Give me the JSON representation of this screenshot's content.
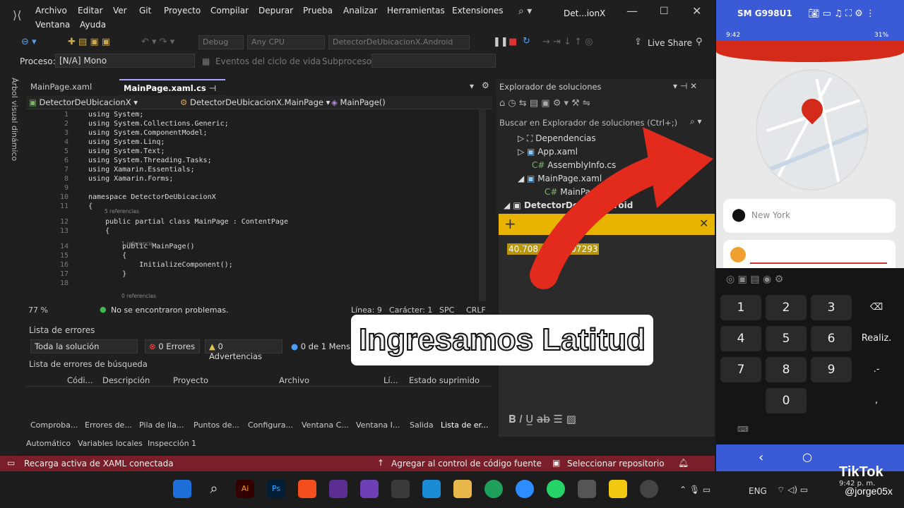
{
  "menu": [
    "Archivo",
    "Editar",
    "Ver",
    "Git",
    "Proyecto",
    "Compilar",
    "Depurar",
    "Prueba",
    "Analizar",
    "Herramientas",
    "Extensiones",
    "Ventana",
    "Ayuda"
  ],
  "window_title": "Det...ionX",
  "toolbar": {
    "config": "Debug",
    "platform": "Any CPU",
    "startup": "DetectorDeUbicacionX.Android",
    "live_share": "Live Share"
  },
  "proc": {
    "label": "Proceso:",
    "value": "[N/A] Mono",
    "events": "Eventos del ciclo de vida",
    "thread": "Subproceso:"
  },
  "side_label": "Árbol visual dinámico",
  "tabs": [
    "MainPage.xaml",
    "MainPage.xaml.cs"
  ],
  "nav": [
    "DetectorDeUbicacionX",
    "DetectorDeUbicacionX.MainPage",
    "MainPage()"
  ],
  "code_lines": [
    {
      "n": "1",
      "t": "using System;"
    },
    {
      "n": "2",
      "t": "using System.Collections.Generic;"
    },
    {
      "n": "3",
      "t": "using System.ComponentModel;"
    },
    {
      "n": "4",
      "t": "using System.Linq;"
    },
    {
      "n": "5",
      "t": "using System.Text;"
    },
    {
      "n": "6",
      "t": "using System.Threading.Tasks;"
    },
    {
      "n": "7",
      "t": "using Xamarin.Essentials;"
    },
    {
      "n": "8",
      "t": "using Xamarin.Forms;"
    },
    {
      "n": "9",
      "t": ""
    },
    {
      "n": "10",
      "t": "namespace DetectorDeUbicacionX"
    },
    {
      "n": "11",
      "t": "{"
    },
    {
      "n": "12",
      "t": "    public partial class MainPage : ContentPage"
    },
    {
      "n": "13",
      "t": "    {"
    },
    {
      "n": "14",
      "t": "        public MainPage()"
    },
    {
      "n": "15",
      "t": "        {"
    },
    {
      "n": "16",
      "t": "            InitializeComponent();"
    },
    {
      "n": "17",
      "t": "        }"
    },
    {
      "n": "18",
      "t": ""
    }
  ],
  "refs": {
    "r5": "5 referencias",
    "r1": "1 referencia",
    "r0": "0 referencias"
  },
  "editor_status": {
    "zoom": "77 %",
    "problems": "No se encontraron problemas.",
    "line": "Línea: 9",
    "col": "Carácter: 1",
    "spc": "SPC",
    "crlf": "CRLF"
  },
  "errors": {
    "title": "Lista de errores",
    "scope": "Toda la solución",
    "errors": "0 Errores",
    "warnings": "0 Advertencias",
    "messages": "0 de 1 Mens",
    "search": "Lista de errores de búsqueda",
    "cols": [
      "Códi...",
      "Descripción",
      "Proyecto",
      "Archivo",
      "Lí...",
      "Estado suprimido"
    ]
  },
  "bottom_tabs": [
    "Comproba...",
    "Errores de...",
    "Pila de lla...",
    "Puntos de...",
    "Configura...",
    "Ventana C...",
    "Ventana I...",
    "Salida",
    "Lista de er..."
  ],
  "bottom_tabs2": [
    "Automático",
    "Variables locales",
    "Inspección 1"
  ],
  "solution": {
    "title": "Explorador de soluciones",
    "search": "Buscar en Explorador de soluciones (Ctrl+;)",
    "items": [
      "Dependencias",
      "App.xaml",
      "AssemblyInfo.cs",
      "MainPage.xaml",
      "MainPage.xa...",
      "DetectorDe...t.Android"
    ]
  },
  "sticky": {
    "text": "40.708... -74.007293"
  },
  "status": {
    "left": "Recarga activa de XAML conectada",
    "mid": "Agregar al control de código fuente",
    "right": "Seleccionar repositorio"
  },
  "phone": {
    "title": "SM G998U1",
    "status_time": "9:42",
    "battery": "31%",
    "city": "New York",
    "keys": [
      "1",
      "2",
      "3",
      "⌫",
      "4",
      "5",
      "6",
      "Realiz.",
      "7",
      "8",
      "9",
      ".-",
      "",
      "0",
      "",
      ","
    ]
  },
  "caption": "Ingresamos Latitud",
  "taskbar": {
    "lang": "ENG",
    "time": "9:42 p. m.",
    "tiktok": "TikTok",
    "handle": "@jorge05x"
  },
  "colors": {
    "accent": "#d42a1a",
    "status": "#7a1e2a",
    "sticky": "#e8b400"
  }
}
